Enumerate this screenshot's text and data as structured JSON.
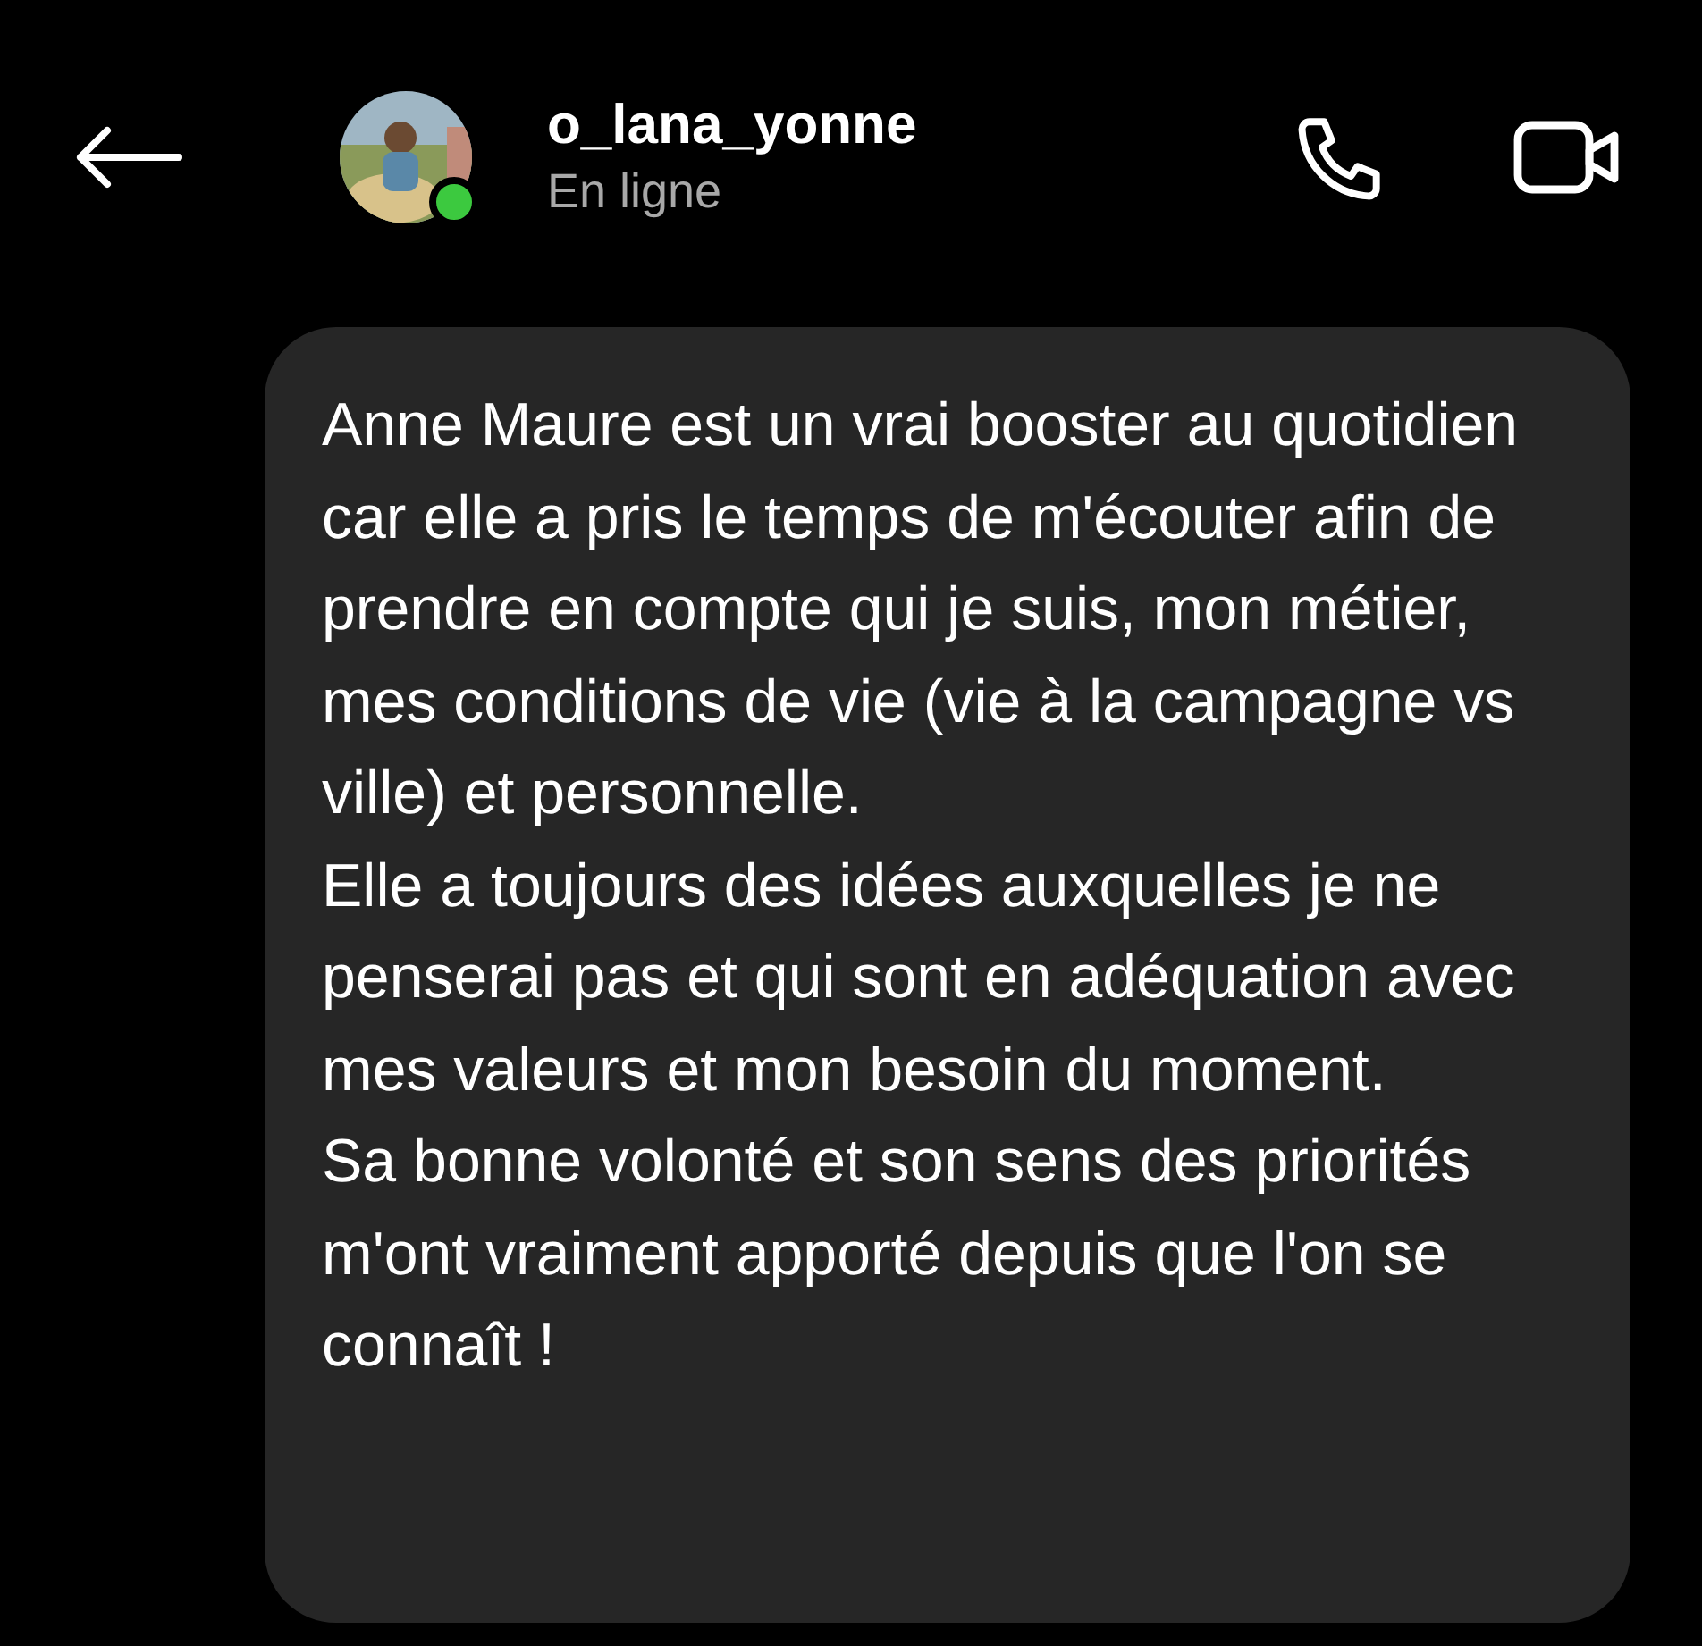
{
  "header": {
    "username": "o_lana_yonne",
    "status": "En ligne",
    "online": true
  },
  "message": {
    "paragraphs": [
      "Anne Maure est un vrai booster au quotidien car elle a pris le temps de m'écouter afin de prendre en compte qui je suis, mon métier, mes conditions de vie (vie à la campagne vs ville) et personnelle.",
      "Elle a toujours des idées auxquelles je ne penserai pas et qui sont en adéquation avec mes valeurs et mon besoin du moment.",
      "Sa bonne volonté et son sens des priorités m'ont vraiment apporté depuis que l'on se connaît !"
    ]
  }
}
